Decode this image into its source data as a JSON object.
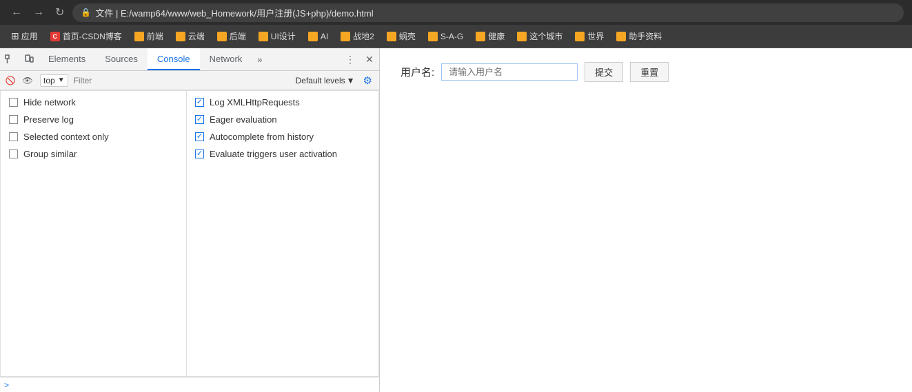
{
  "browser": {
    "back_btn": "←",
    "forward_btn": "→",
    "refresh_btn": "↻",
    "address": "文件 | E:/wamp64/www/web_Homework/用户注册(JS+php)/demo.html"
  },
  "bookmarks": {
    "apps_label": "应用",
    "items": [
      {
        "label": "首页-CSDN博客",
        "color": "#e53935",
        "icon": "C"
      },
      {
        "label": "前端",
        "color": "#f5a623"
      },
      {
        "label": "云端",
        "color": "#f5a623"
      },
      {
        "label": "后端",
        "color": "#f5a623"
      },
      {
        "label": "UI设计",
        "color": "#f5a623"
      },
      {
        "label": "AI",
        "color": "#f5a623"
      },
      {
        "label": "战地2",
        "color": "#f5a623"
      },
      {
        "label": "蜗壳",
        "color": "#f5a623"
      },
      {
        "label": "S-A-G",
        "color": "#f5a623"
      },
      {
        "label": "健康",
        "color": "#f5a623"
      },
      {
        "label": "这个城市",
        "color": "#f5a623"
      },
      {
        "label": "世界",
        "color": "#f5a623"
      },
      {
        "label": "助手资料",
        "color": "#f5a623"
      }
    ]
  },
  "devtools": {
    "tabs": [
      {
        "label": "Elements",
        "active": false
      },
      {
        "label": "Sources",
        "active": false
      },
      {
        "label": "Console",
        "active": true
      },
      {
        "label": "Network",
        "active": false
      }
    ],
    "more_label": "»",
    "top_selector": "top",
    "filter_placeholder": "Filter",
    "default_levels": "Default levels",
    "dropdown_chevron": "▼",
    "left_items": [
      {
        "label": "Hide network",
        "checked": false
      },
      {
        "label": "Preserve log",
        "checked": false
      },
      {
        "label": "Selected context only",
        "checked": false
      },
      {
        "label": "Group similar",
        "checked": false
      }
    ],
    "right_items": [
      {
        "label": "Log XMLHttpRequests",
        "checked": true
      },
      {
        "label": "Eager evaluation",
        "checked": true
      },
      {
        "label": "Autocomplete from history",
        "checked": true
      },
      {
        "label": "Evaluate triggers user activation",
        "checked": true
      }
    ],
    "console_chevron": ">"
  },
  "page": {
    "form": {
      "label": "用户名:",
      "placeholder": "请输入用户名",
      "submit_label": "提交",
      "reset_label": "重置"
    }
  }
}
